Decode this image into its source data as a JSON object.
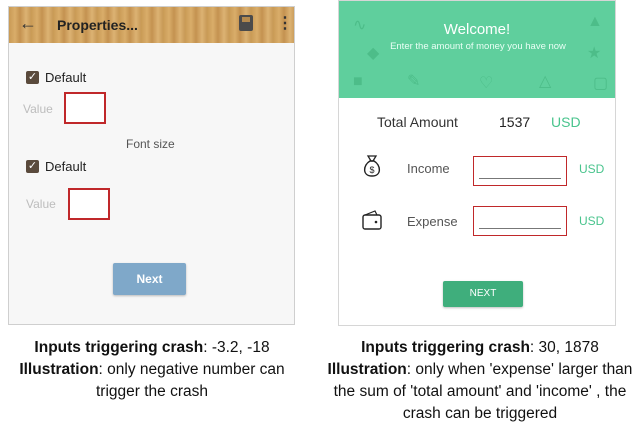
{
  "left_app": {
    "title": "Properties...",
    "back_icon": "arrow-left-icon",
    "save_icon": "save-icon",
    "menu_icon": "more-vert-icon",
    "checkbox1_label": "Default",
    "value1_placeholder": "Value",
    "font_size_label": "Font size",
    "checkbox2_label": "Default",
    "value2_placeholder": "Value",
    "next_label": "Next",
    "colors": {
      "highlight": "#c0282a",
      "next_button": "#7fa8c9"
    }
  },
  "right_app": {
    "welcome_title": "Welcome!",
    "welcome_subtitle": "Enter the amount of money you have now",
    "total_label": "Total Amount",
    "total_value": "1537",
    "total_currency": "USD",
    "income_label": "Income",
    "income_currency": "USD",
    "expense_label": "Expense",
    "expense_currency": "USD",
    "next_label": "NEXT",
    "income_icon": "money-bag-icon",
    "expense_icon": "wallet-icon",
    "colors": {
      "header": "#5fcf9d",
      "accent": "#49c48d",
      "highlight": "#c0282a"
    }
  },
  "captions": {
    "left": {
      "inputs_label": "Inputs triggering crash",
      "inputs_value": ": -3.2, -18",
      "illustration_label": "Illustration",
      "illustration_text": ": only negative number can trigger the crash"
    },
    "right": {
      "inputs_label": "Inputs triggering crash",
      "inputs_value": ": 30, 1878",
      "illustration_label": "Illustration",
      "illustration_text": ": only when 'expense' larger than the sum of 'total amount' and 'income' , the crash can be triggered"
    }
  }
}
